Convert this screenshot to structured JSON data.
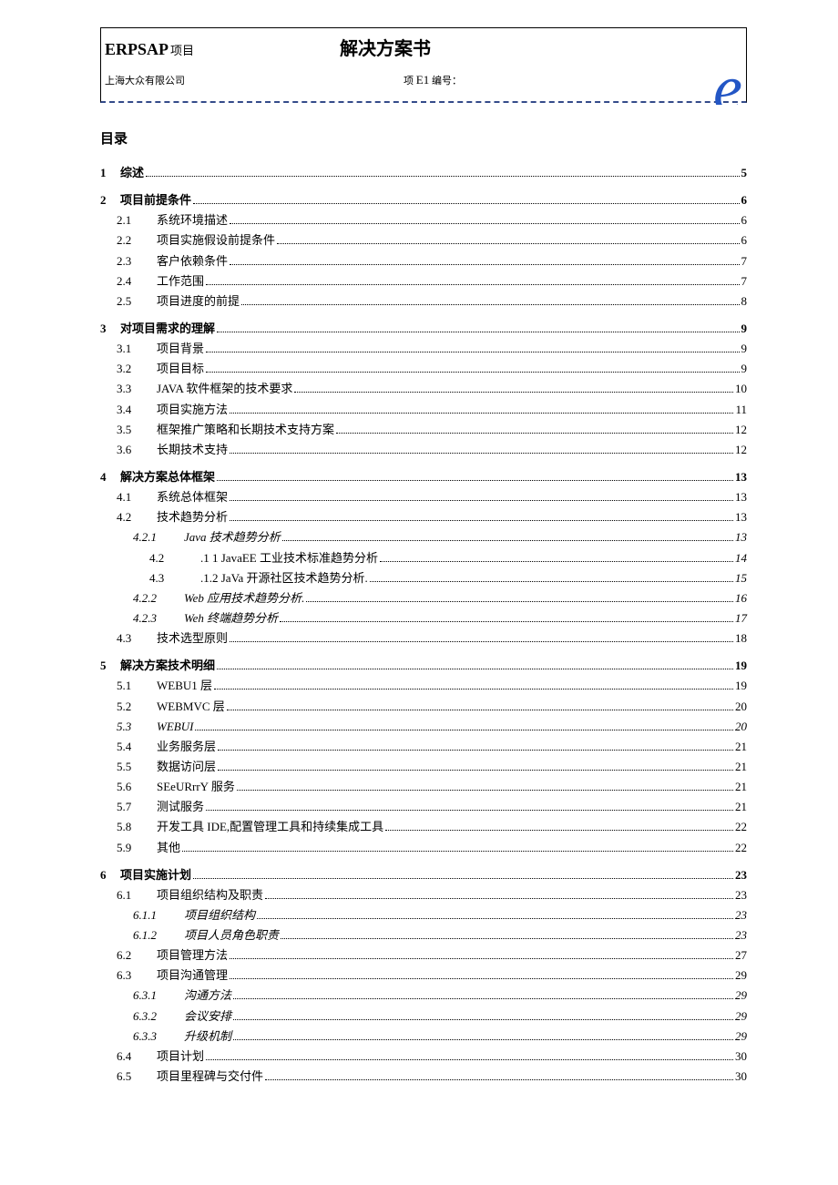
{
  "header": {
    "brand": "ERPSAP",
    "brand_suffix": "项目",
    "title": "解决方案书",
    "company": "上海大众有限公司",
    "code_prefix": "项",
    "code": "E1",
    "code_suffix": "编号："
  },
  "toc_heading": "目录",
  "toc": [
    {
      "level": 1,
      "num": "1",
      "text": "综述",
      "page": "5"
    },
    {
      "level": 1,
      "num": "2",
      "text": "项目前提条件",
      "page": "6"
    },
    {
      "level": 2,
      "num": "2.1",
      "text": "系统环境描述",
      "page": "6"
    },
    {
      "level": 2,
      "num": "2.2",
      "text": "项目实施假设前提条件",
      "page": "6"
    },
    {
      "level": 2,
      "num": "2.3",
      "text": "客户依赖条件",
      "page": "7"
    },
    {
      "level": 2,
      "num": "2.4",
      "text": "工作范围",
      "page": "7"
    },
    {
      "level": 2,
      "num": "2.5",
      "text": "项目进度的前提",
      "page": "8"
    },
    {
      "level": 1,
      "num": "3",
      "text": "对项目需求的理解",
      "page": "9"
    },
    {
      "level": 2,
      "num": "3.1",
      "text": "项目背景",
      "page": "9"
    },
    {
      "level": 2,
      "num": "3.2",
      "text": "项目目标",
      "page": "9"
    },
    {
      "level": 2,
      "num": "3.3",
      "text": "JAVA 软件框架的技术要求",
      "page": "10",
      "sc": true
    },
    {
      "level": 2,
      "num": "3.4",
      "text": "项目实施方法",
      "page": "11"
    },
    {
      "level": 2,
      "num": "3.5",
      "text": "框架推广策略和长期技术支持方案",
      "page": "12"
    },
    {
      "level": 2,
      "num": "3.6",
      "text": "长期技术支持",
      "page": "12"
    },
    {
      "level": 1,
      "num": "4",
      "text": "解决方案总体框架",
      "page": "13"
    },
    {
      "level": 2,
      "num": "4.1",
      "text": "系统总体框架",
      "page": "13"
    },
    {
      "level": 2,
      "num": "4.2",
      "text": "技术趋势分析",
      "page": "13"
    },
    {
      "level": 3,
      "num": "4.2.1",
      "text": "Java 技术趋势分析",
      "page": "13"
    },
    {
      "level": 4,
      "num": "4.2",
      "text": ".1 1 JavaEE 工业技术标准趋势分析",
      "page": "14"
    },
    {
      "level": 4,
      "num": "4.3",
      "text": ".1.2 JaVa 开源社区技术趋势分析.",
      "page": "15"
    },
    {
      "level": 3,
      "num": "4.2.2",
      "text": "Web 应用技术趋势分析.",
      "page": "16"
    },
    {
      "level": 3,
      "num": "4.2.3",
      "text": "Weh 终端趋势分析",
      "page": "17"
    },
    {
      "level": 2,
      "num": "4.3",
      "text": "技术选型原则",
      "page": "18"
    },
    {
      "level": 1,
      "num": "5",
      "text": "解决方案技术明细",
      "page": "19"
    },
    {
      "level": 2,
      "num": "5.1",
      "text": "WEBU1 层",
      "page": "19"
    },
    {
      "level": 2,
      "num": "5.2",
      "text": "WEBMVC 层",
      "page": "20"
    },
    {
      "level": 2,
      "num": "5.3",
      "text": "WEBUI",
      "page": "20",
      "italic": true
    },
    {
      "level": 2,
      "num": "5.4",
      "text": "业务服务层",
      "page": "21"
    },
    {
      "level": 2,
      "num": "5.5",
      "text": "数据访问层",
      "page": "21"
    },
    {
      "level": 2,
      "num": "5.6",
      "text": "SEeURrrY 服务",
      "page": "21"
    },
    {
      "level": 2,
      "num": "5.7",
      "text": "测试服务",
      "page": "21"
    },
    {
      "level": 2,
      "num": "5.8",
      "text": "开发工具 IDE,配置管理工具和持续集成工具",
      "page": "22"
    },
    {
      "level": 2,
      "num": "5.9",
      "text": "其他",
      "page": "22"
    },
    {
      "level": 1,
      "num": "6",
      "text": "项目实施计划",
      "page": "23"
    },
    {
      "level": 2,
      "num": "6.1",
      "text": "项目组织结构及职责",
      "page": "23"
    },
    {
      "level": 3,
      "num": "6.1.1",
      "text": "项目组织结构",
      "page": "23"
    },
    {
      "level": 3,
      "num": "6.1.2",
      "text": "项目人员角色职责",
      "page": "23"
    },
    {
      "level": 2,
      "num": "6.2",
      "text": "项目管理方法",
      "page": "27"
    },
    {
      "level": 2,
      "num": "6.3",
      "text": "项目沟通管理",
      "page": "29"
    },
    {
      "level": 3,
      "num": "6.3.1",
      "text": "沟通方法",
      "page": "29"
    },
    {
      "level": 3,
      "num": "6.3.2",
      "text": "会议安排",
      "page": "29"
    },
    {
      "level": 3,
      "num": "6.3.3",
      "text": "升级机制",
      "page": "29"
    },
    {
      "level": 2,
      "num": "6.4",
      "text": "项目计划",
      "page": "30"
    },
    {
      "level": 2,
      "num": "6.5",
      "text": "项目里程碑与交付件",
      "page": "30"
    }
  ]
}
